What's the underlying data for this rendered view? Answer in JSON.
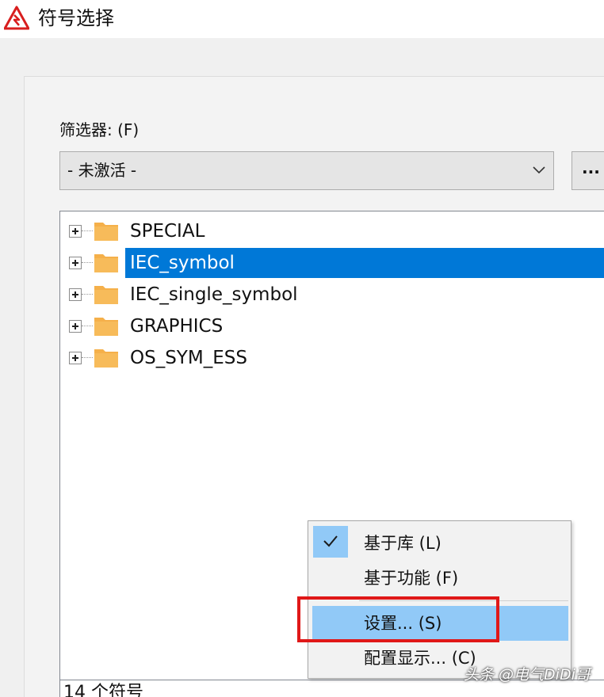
{
  "window": {
    "title": "符号选择",
    "icon": "app-logo-icon"
  },
  "filter": {
    "label": "筛选器: (F)",
    "selected_value": "- 未激活 -",
    "more_button_label": "..."
  },
  "tree": {
    "items": [
      {
        "label": "SPECIAL",
        "selected": false,
        "icon": "folder-icon"
      },
      {
        "label": "IEC_symbol",
        "selected": true,
        "icon": "folder-icon"
      },
      {
        "label": "IEC_single_symbol",
        "selected": false,
        "icon": "folder-icon"
      },
      {
        "label": "GRAPHICS",
        "selected": false,
        "icon": "folder-icon"
      },
      {
        "label": "OS_SYM_ESS",
        "selected": false,
        "icon": "folder-icon"
      }
    ]
  },
  "context_menu": {
    "items": [
      {
        "label": "基于库 (L)",
        "checked": true
      },
      {
        "label": "基于功能 (F)",
        "checked": false
      },
      {
        "label": "设置... (S)",
        "checked": false,
        "highlighted": true
      },
      {
        "label": "配置显示... (C)",
        "checked": false
      }
    ]
  },
  "status": {
    "text": "14 个符号"
  },
  "watermark": {
    "text": "头条 @电气DiDi哥"
  },
  "colors": {
    "selection": "#0078d7",
    "menu_highlight": "#91c9f7",
    "annotation": "#e01818",
    "folder": "#f5b04a"
  }
}
